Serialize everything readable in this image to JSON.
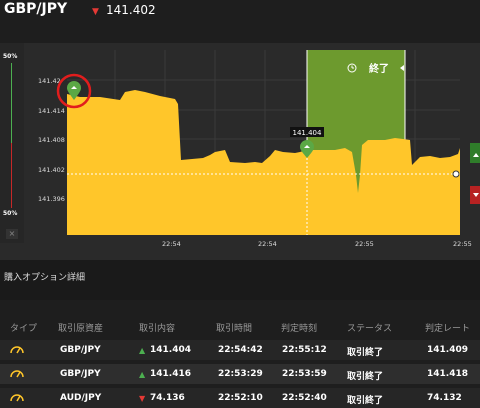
{
  "header": {
    "pair": "GBP/JPY",
    "direction_icon": "down-arrow-icon",
    "price": "141.402"
  },
  "left_panel": {
    "top_pct": "50%",
    "bottom_pct": "50%",
    "close_label": "×"
  },
  "chart": {
    "y_ticks": [
      "141.42",
      "141.414",
      "141.408",
      "141.402",
      "141.396"
    ],
    "x_ticks": [
      "22:54",
      "22:54",
      "22:55",
      "22:55"
    ],
    "current_price_tag": "141.404",
    "overlay_label": "終了",
    "overlay_icon": "clock-icon",
    "colors": {
      "area": "#ffc62a",
      "overlay": "#6d9a2e",
      "marker": "#5ba845",
      "highlight": "#e11d1d"
    }
  },
  "section": {
    "title": "購入オプション詳細"
  },
  "table": {
    "headers": [
      "タイプ",
      "取引原資産",
      "取引内容",
      "取引時間",
      "判定時刻",
      "ステータス",
      "判定レート"
    ],
    "rows": [
      {
        "type_icon": "gauge-icon",
        "asset": "GBP/JPY",
        "dir": "up",
        "content": "141.404",
        "time": "22:54:42",
        "judge": "22:55:12",
        "status": "取引終了",
        "rate": "141.409"
      },
      {
        "type_icon": "gauge-icon",
        "asset": "GBP/JPY",
        "dir": "up",
        "content": "141.416",
        "time": "22:53:29",
        "judge": "22:53:59",
        "status": "取引終了",
        "rate": "141.418"
      },
      {
        "type_icon": "gauge-icon",
        "asset": "AUD/JPY",
        "dir": "down",
        "content": "74.136",
        "time": "22:52:10",
        "judge": "22:52:40",
        "status": "取引終了",
        "rate": "74.132"
      }
    ]
  }
}
